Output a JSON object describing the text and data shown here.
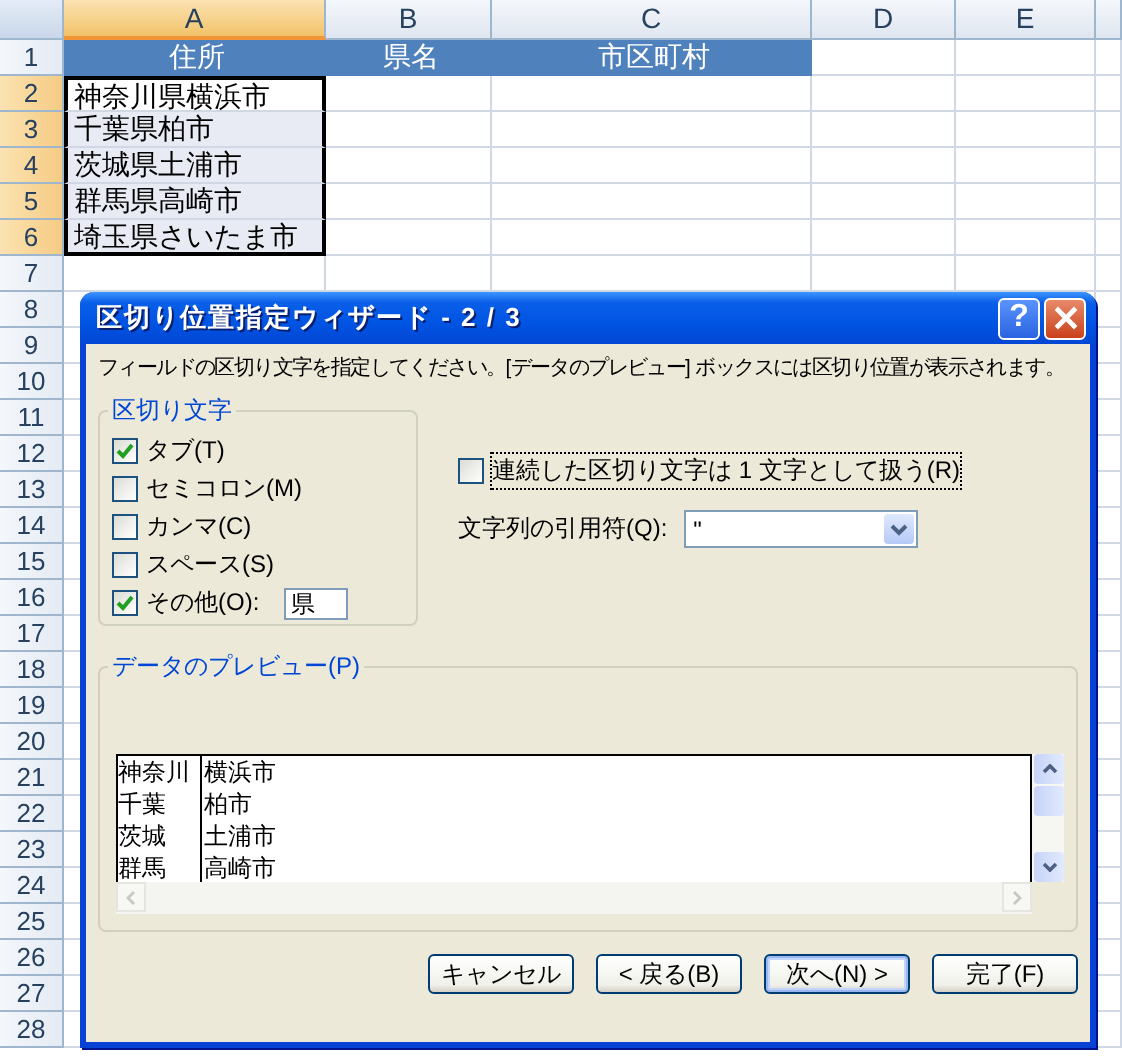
{
  "sheet": {
    "columns": [
      {
        "label": "A",
        "selected": true
      },
      {
        "label": "B",
        "selected": false
      },
      {
        "label": "C",
        "selected": false
      },
      {
        "label": "D",
        "selected": false
      },
      {
        "label": "E",
        "selected": false
      }
    ],
    "rows": [
      {
        "label": "1",
        "kind": "header",
        "selected": false,
        "cells": [
          "住所",
          "県名",
          "市区町村"
        ]
      },
      {
        "label": "2",
        "kind": "data",
        "selected": true,
        "active": true,
        "cells": [
          "神奈川県横浜市"
        ]
      },
      {
        "label": "3",
        "kind": "data",
        "selected": true,
        "active": false,
        "cells": [
          "千葉県柏市"
        ]
      },
      {
        "label": "4",
        "kind": "data",
        "selected": true,
        "active": false,
        "cells": [
          "茨城県土浦市"
        ]
      },
      {
        "label": "5",
        "kind": "data",
        "selected": true,
        "active": false,
        "cells": [
          "群馬県高崎市"
        ]
      },
      {
        "label": "6",
        "kind": "data",
        "selected": true,
        "active": false,
        "cells": [
          "埼玉県さいたま市"
        ]
      },
      {
        "label": "7",
        "kind": "empty",
        "selected": false
      },
      {
        "label": "8",
        "kind": "empty",
        "selected": false
      },
      {
        "label": "9",
        "kind": "empty",
        "selected": false
      },
      {
        "label": "10",
        "kind": "empty",
        "selected": false
      },
      {
        "label": "11",
        "kind": "empty",
        "selected": false
      },
      {
        "label": "12",
        "kind": "empty",
        "selected": false
      },
      {
        "label": "13",
        "kind": "empty",
        "selected": false
      },
      {
        "label": "14",
        "kind": "empty",
        "selected": false
      },
      {
        "label": "15",
        "kind": "empty",
        "selected": false
      },
      {
        "label": "16",
        "kind": "empty",
        "selected": false
      },
      {
        "label": "17",
        "kind": "empty",
        "selected": false
      },
      {
        "label": "18",
        "kind": "empty",
        "selected": false
      },
      {
        "label": "19",
        "kind": "empty",
        "selected": false
      },
      {
        "label": "20",
        "kind": "empty",
        "selected": false
      },
      {
        "label": "21",
        "kind": "empty",
        "selected": false
      },
      {
        "label": "22",
        "kind": "empty",
        "selected": false
      },
      {
        "label": "23",
        "kind": "empty",
        "selected": false
      },
      {
        "label": "24",
        "kind": "empty",
        "selected": false
      },
      {
        "label": "25",
        "kind": "empty",
        "selected": false
      },
      {
        "label": "26",
        "kind": "empty",
        "selected": false
      },
      {
        "label": "27",
        "kind": "empty",
        "selected": false
      },
      {
        "label": "28",
        "kind": "empty",
        "selected": false
      }
    ]
  },
  "dialog": {
    "title": "区切り位置指定ウィザード - 2 / 3",
    "help": "?",
    "instruction": "フィールドの区切り文字を指定してください。[データのプレビュー] ボックスには区切り位置が表示されます。",
    "delimiters": {
      "legend": "区切り文字",
      "items": [
        {
          "label": "タブ(T)",
          "checked": true,
          "kind": "plain"
        },
        {
          "label": "セミコロン(M)",
          "checked": false,
          "kind": "plain"
        },
        {
          "label": "カンマ(C)",
          "checked": false,
          "kind": "plain"
        },
        {
          "label": "スペース(S)",
          "checked": false,
          "kind": "plain"
        },
        {
          "label": "その他(O):",
          "checked": true,
          "kind": "other",
          "value": "県"
        }
      ]
    },
    "consecutive": {
      "label": "連続した区切り文字は 1 文字として扱う(R)",
      "checked": false
    },
    "quote": {
      "label": "文字列の引用符(Q):",
      "value": "\""
    },
    "preview": {
      "legend": "データのプレビュー(P)",
      "rows": [
        [
          "神奈川",
          "横浜市"
        ],
        [
          "千葉",
          "柏市"
        ],
        [
          "茨城",
          "土浦市"
        ],
        [
          "群馬",
          "高崎市"
        ]
      ]
    },
    "buttons": [
      {
        "label": "キャンセル",
        "default": false
      },
      {
        "label": "< 戻る(B)",
        "default": false
      },
      {
        "label": "次へ(N) >",
        "default": true
      },
      {
        "label": "完了(F)",
        "default": false
      }
    ]
  }
}
